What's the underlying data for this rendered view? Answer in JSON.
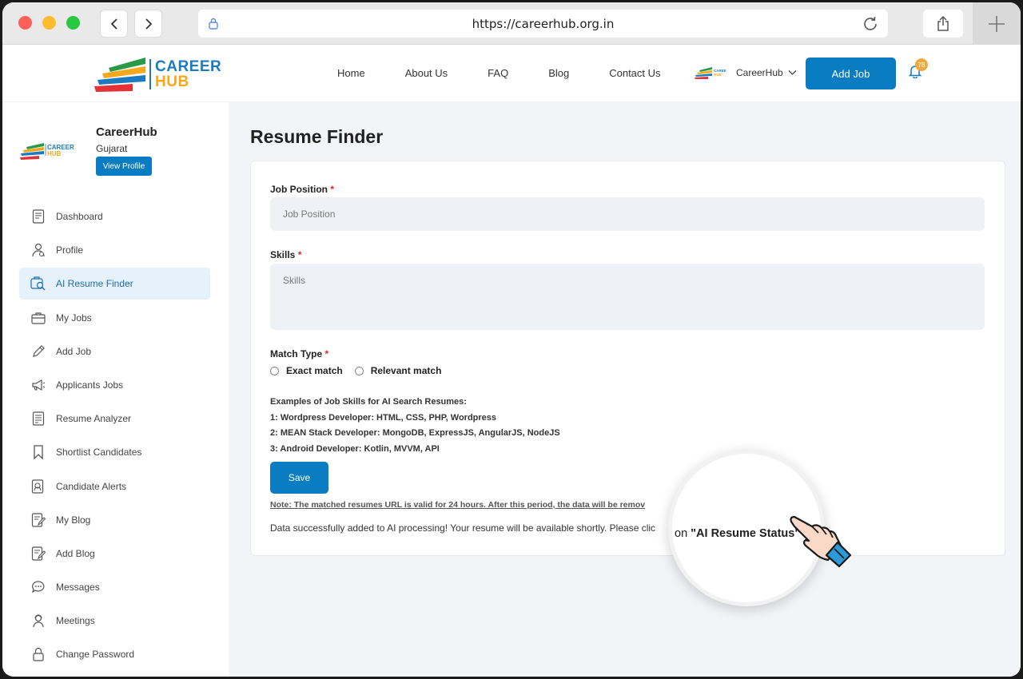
{
  "browser": {
    "url": "https://careerhub.org.in"
  },
  "header": {
    "logo_line1": "CAREER",
    "logo_line2": "HUB",
    "nav": [
      "Home",
      "About Us",
      "FAQ",
      "Blog",
      "Contact Us"
    ],
    "user_name": "CareerHub",
    "add_job_label": "Add Job",
    "notification_count": "78"
  },
  "sidebar": {
    "profile_name": "CareerHub",
    "profile_location": "Gujarat",
    "view_profile_label": "View Profile",
    "items": [
      {
        "label": "Dashboard",
        "icon": "dashboard-icon"
      },
      {
        "label": "Profile",
        "icon": "profile-icon"
      },
      {
        "label": "AI Resume Finder",
        "icon": "ai-resume-finder-icon",
        "active": true
      },
      {
        "label": "My Jobs",
        "icon": "briefcase-icon"
      },
      {
        "label": "Add Job",
        "icon": "pencil-icon"
      },
      {
        "label": "Applicants Jobs",
        "icon": "megaphone-icon"
      },
      {
        "label": "Resume Analyzer",
        "icon": "document-icon"
      },
      {
        "label": "Shortlist Candidates",
        "icon": "bookmark-icon"
      },
      {
        "label": "Candidate Alerts",
        "icon": "alert-icon"
      },
      {
        "label": "My Blog",
        "icon": "blog-icon"
      },
      {
        "label": "Add Blog",
        "icon": "add-blog-icon"
      },
      {
        "label": "Messages",
        "icon": "chat-icon"
      },
      {
        "label": "Meetings",
        "icon": "meeting-icon"
      },
      {
        "label": "Change Password",
        "icon": "lock-icon"
      }
    ]
  },
  "main": {
    "title": "Resume Finder",
    "job_position_label": "Job Position",
    "job_position_placeholder": "Job Position",
    "skills_label": "Skills",
    "skills_placeholder": "Skills",
    "required_mark": "*",
    "match_type_label": "Match Type",
    "match_options": [
      "Exact match",
      "Relevant match"
    ],
    "examples_title": "Examples of Job Skills for AI Search Resumes:",
    "examples": [
      "1: Wordpress Developer: HTML, CSS, PHP, Wordpress",
      "2: MEAN Stack Developer: MongoDB, ExpressJS, AngularJS, NodeJS",
      "3: Android Developer: Kotlin, MVVM, API"
    ],
    "save_label": "Save",
    "note": "Note: The matched resumes URL is valid for 24 hours. After this period, the data will be remov",
    "success_message": "Data successfully added to AI processing! Your resume will be available shortly. Please clic",
    "magnifier_prefix": "on ",
    "magnifier_bold": "\"AI Resume Status\""
  },
  "colors": {
    "primary": "#0a7cc2",
    "active_bg": "#e6f2fb",
    "badge": "#f0a93b",
    "required": "#d9262a"
  }
}
